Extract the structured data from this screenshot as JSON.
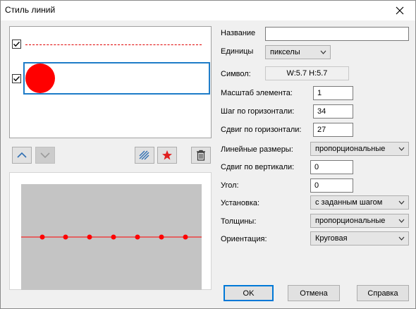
{
  "window": {
    "title": "Стиль линий"
  },
  "style_list": {
    "items": [
      {
        "checked": true,
        "kind": "dashed-line"
      },
      {
        "checked": true,
        "kind": "circle-symbol",
        "selected": true
      }
    ]
  },
  "form": {
    "name_label": "Название",
    "name_value": "",
    "units_label": "Единицы",
    "units_value": "пикселы",
    "symbol_label": "Символ:",
    "symbol_value": "W:5.7  H:5.7",
    "scale_label": "Масштаб элемента:",
    "scale_value": "1",
    "hstep_label": "Шаг по горизонтали:",
    "hstep_value": "34",
    "hshift_label": "Сдвиг по горизонтали:",
    "hshift_value": "27",
    "linear_sizes_label": "Линейные размеры:",
    "linear_sizes_value": "пропорциональные",
    "vshift_label": "Сдвиг по вертикали:",
    "vshift_value": "0",
    "angle_label": "Угол:",
    "angle_value": "0",
    "placement_label": "Установка:",
    "placement_value": "с заданным шагом",
    "thickness_label": "Толщины:",
    "thickness_value": "пропорциональные",
    "orientation_label": "Ориентация:",
    "orientation_value": "Круговая"
  },
  "buttons": {
    "ok": "OK",
    "cancel": "Отмена",
    "help": "Справка"
  },
  "colors": {
    "accent": "#1e7cc8",
    "symbol": "#ff0000",
    "toolbar_icon": "#2f6fb3"
  }
}
